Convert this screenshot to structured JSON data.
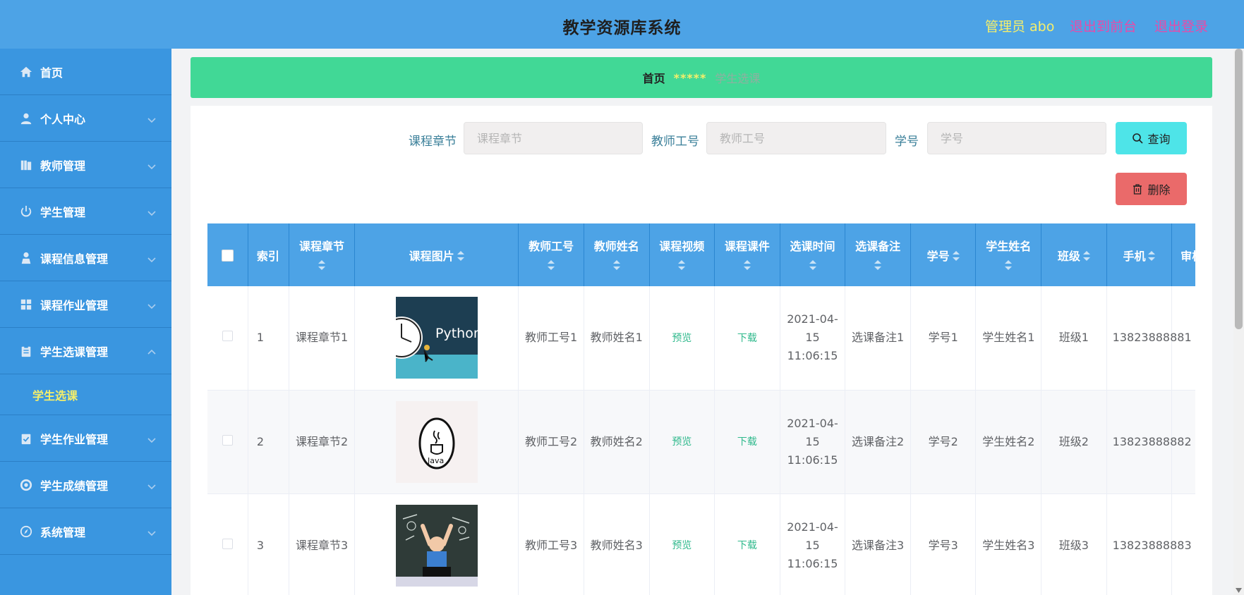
{
  "header": {
    "title": "教学资源库系统",
    "admin_label": "管理员 abo",
    "front_link": "退出到前台",
    "logout_link": "退出登录"
  },
  "sidebar": {
    "items": [
      {
        "label": "首页",
        "icon": "home-icon"
      },
      {
        "label": "个人中心",
        "icon": "user-icon"
      },
      {
        "label": "教师管理",
        "icon": "book-icon"
      },
      {
        "label": "学生管理",
        "icon": "power-icon"
      },
      {
        "label": "课程信息管理",
        "icon": "person-icon"
      },
      {
        "label": "课程作业管理",
        "icon": "grid-icon"
      },
      {
        "label": "学生选课管理",
        "icon": "clipboard-icon"
      },
      {
        "label": "学生作业管理",
        "icon": "task-icon"
      },
      {
        "label": "学生成绩管理",
        "icon": "target-icon"
      },
      {
        "label": "系统管理",
        "icon": "compass-icon"
      }
    ],
    "submenu_item": "学生选课"
  },
  "breadcrumb": {
    "home": "首页",
    "separator": "*****",
    "current": "学生选课"
  },
  "search": {
    "chapter_label": "课程章节",
    "chapter_placeholder": "课程章节",
    "teacher_no_label": "教师工号",
    "teacher_no_placeholder": "教师工号",
    "student_no_label": "学号",
    "student_no_placeholder": "学号",
    "query_button": "查询",
    "delete_button": "删除"
  },
  "table": {
    "headers": {
      "index": "索引",
      "chapter": "课程章节",
      "image": "课程图片",
      "teacher_no": "教师工号",
      "teacher_name": "教师姓名",
      "video": "课程视频",
      "courseware": "课程课件",
      "select_time": "选课时间",
      "remark": "选课备注",
      "student_no": "学号",
      "student_name": "学生姓名",
      "class": "班级",
      "phone": "手机",
      "audit": "审核"
    },
    "rows": [
      {
        "index": "1",
        "chapter": "课程章节1",
        "image": "python-image",
        "teacher_no": "教师工号1",
        "teacher_name": "教师姓名1",
        "video": "预览",
        "courseware": "下载",
        "select_time": "2021-04-15 11:06:15",
        "remark": "选课备注1",
        "student_no": "学号1",
        "student_name": "学生姓名1",
        "class": "班级1",
        "phone": "13823888881"
      },
      {
        "index": "2",
        "chapter": "课程章节2",
        "image": "java-image",
        "teacher_no": "教师工号2",
        "teacher_name": "教师姓名2",
        "video": "预览",
        "courseware": "下载",
        "select_time": "2021-04-15 11:06:15",
        "remark": "选课备注2",
        "student_no": "学号2",
        "student_name": "学生姓名2",
        "class": "班级2",
        "phone": "13823888882"
      },
      {
        "index": "3",
        "chapter": "课程章节3",
        "image": "student-chalkboard-image",
        "teacher_no": "教师工号3",
        "teacher_name": "教师姓名3",
        "video": "预览",
        "courseware": "下载",
        "select_time": "2021-04-15 11:06:15",
        "remark": "选课备注3",
        "student_no": "学号3",
        "student_name": "学生姓名3",
        "class": "班级3",
        "phone": "13823888883"
      }
    ]
  },
  "colors": {
    "header_bg": "#4da3e6",
    "sidebar_bg": "#3a96e0",
    "breadcrumb_bg": "#41d896",
    "query_button_bg": "#4ee4e8",
    "delete_button_bg": "#ea6a6a",
    "highlight_text": "#f6ef6a",
    "link_text": "#e94aa8",
    "table_link": "#2fb98c"
  }
}
